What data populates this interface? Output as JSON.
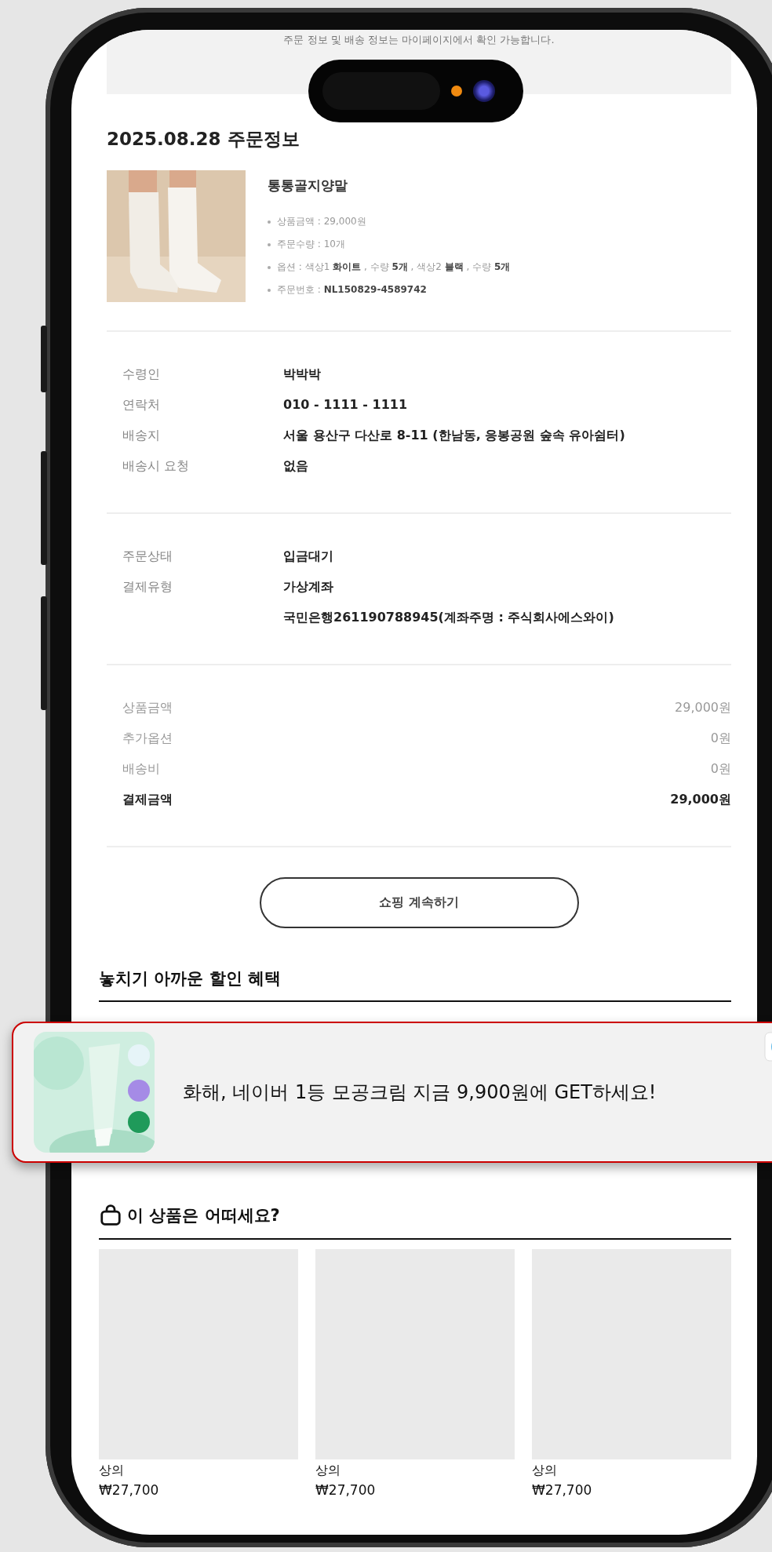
{
  "notice": "주문 정보 및 배송 정보는 마이페이지에서 확인 가능합니다.",
  "order": {
    "title": "2025.08.28 주문정보",
    "product": {
      "name": "통통골지양말",
      "details": [
        "상품금액 : 29,000원",
        "주문수량 : 10개",
        "옵션 : 색상1 **화이트** , 수량 **5개** , 색상2 **블랙** , 수량 **5개**",
        "주문번호 : **NL150829-4589742**"
      ]
    }
  },
  "delivery": [
    {
      "label": "수령인",
      "values": [
        "박박박"
      ]
    },
    {
      "label": "연락처",
      "values": [
        "010 - 1111 - 1111"
      ]
    },
    {
      "label": "배송지",
      "values": [
        "서울 용산구 다산로 8-11 (한남동, 응봉공원 숲속 유아쉼터)"
      ]
    },
    {
      "label": "배송시 요청",
      "values": [
        "없음"
      ]
    }
  ],
  "payment": [
    {
      "label": "주문상태",
      "values": [
        "입금대기"
      ]
    },
    {
      "label": "결제유형",
      "values": [
        "가상계좌",
        "국민은행261190788945(계좌주명 : 주식회사에스와이)"
      ]
    }
  ],
  "amounts": [
    {
      "label": "상품금액",
      "value": "29,000원",
      "total": false
    },
    {
      "label": "추가옵션",
      "value": "0원",
      "total": false
    },
    {
      "label": "배송비",
      "value": "0원",
      "total": false
    },
    {
      "label": "결제금액",
      "value": "29,000원",
      "total": true
    }
  ],
  "continue_button": "쇼핑 계속하기",
  "discount_heading": "놓치기 아까운 할인 혜택",
  "ad": {
    "text": "화해, 네이버 1등 모공크림 지금 9,900원에 GET하세요!"
  },
  "recommend": {
    "title": "이 상품은 어떠세요?",
    "items": [
      {
        "category": "상의",
        "price": "₩27,700"
      },
      {
        "category": "상의",
        "price": "₩27,700"
      },
      {
        "category": "상의",
        "price": "₩27,700"
      }
    ]
  }
}
